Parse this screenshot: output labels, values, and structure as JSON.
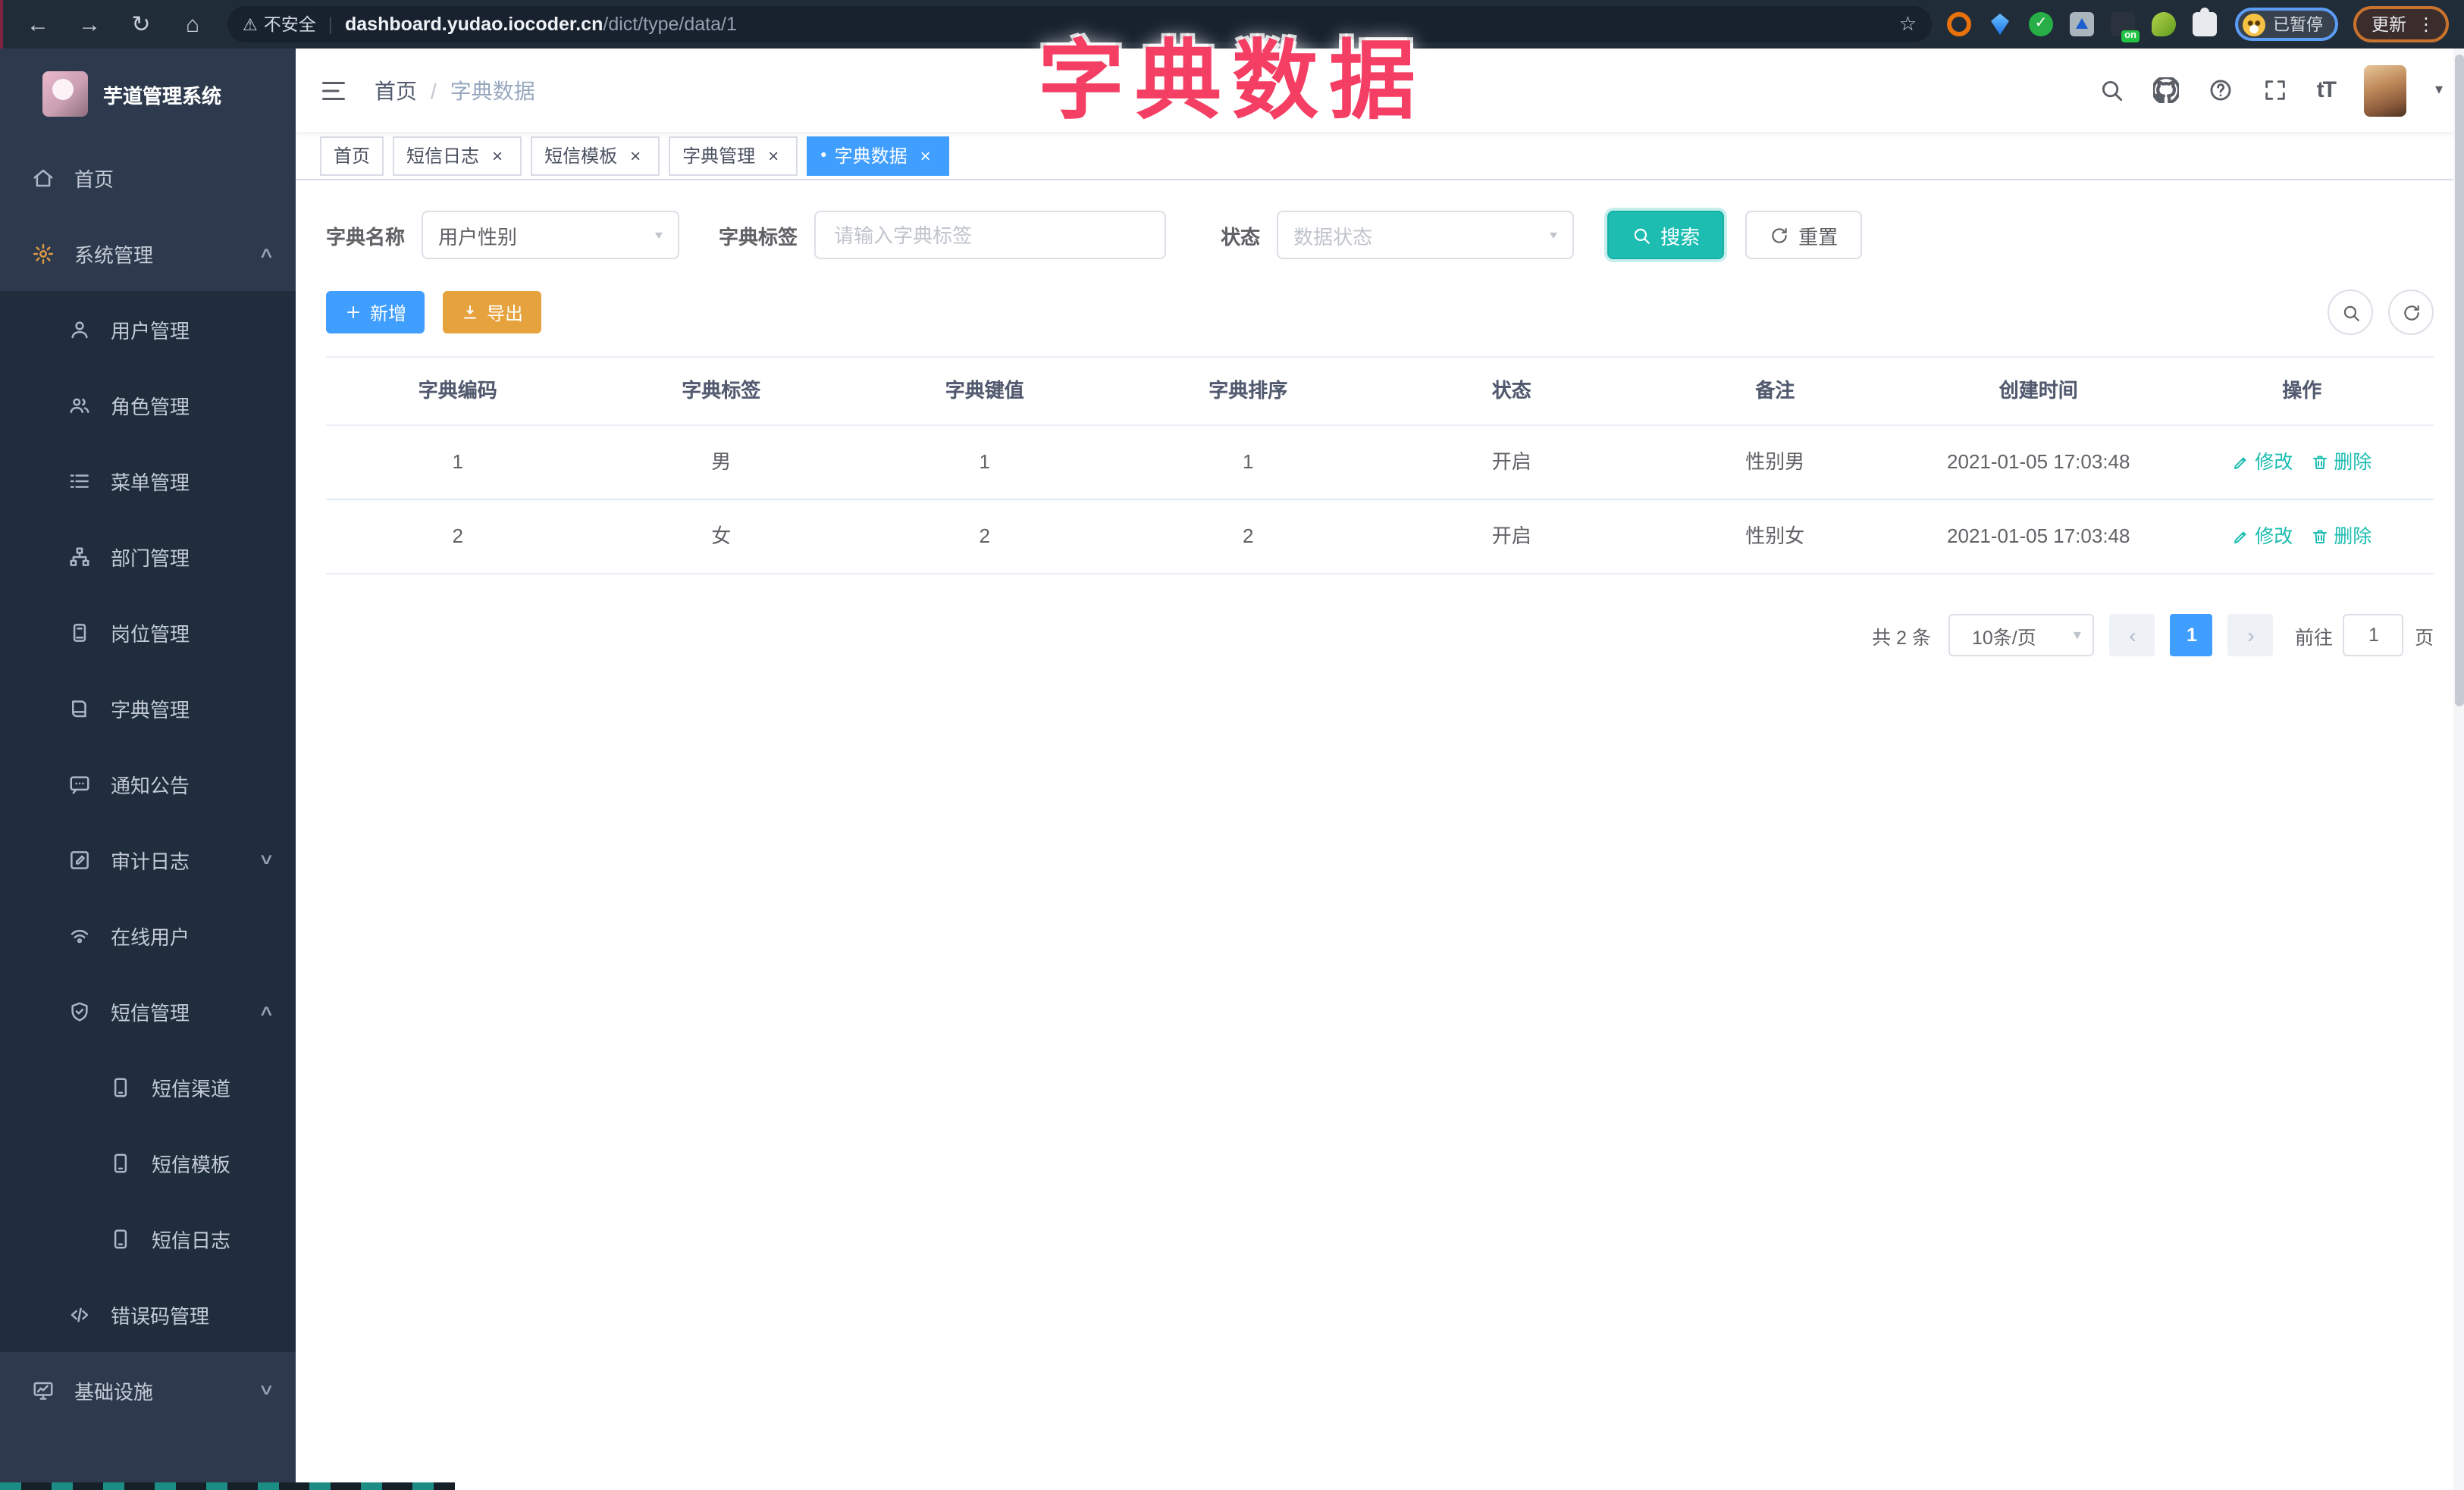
{
  "chrome": {
    "security_label": "不安全",
    "url_domain": "dashboard.yudao.iocoder.cn",
    "url_path": "/dict/type/data/1",
    "profile_status_label": "已暂停",
    "update_label": "更新"
  },
  "overlay_title": "字典数据",
  "sidebar": {
    "logo_title": "芋道管理系统",
    "items": [
      {
        "label": "首页",
        "icon": "home-icon",
        "level": 1
      },
      {
        "label": "系统管理",
        "icon": "gear-icon",
        "level": 1,
        "expanded": true
      },
      {
        "label": "用户管理",
        "icon": "user-icon",
        "level": 2
      },
      {
        "label": "角色管理",
        "icon": "users-icon",
        "level": 2
      },
      {
        "label": "菜单管理",
        "icon": "list-icon",
        "level": 2
      },
      {
        "label": "部门管理",
        "icon": "tree-icon",
        "level": 2
      },
      {
        "label": "岗位管理",
        "icon": "badge-icon",
        "level": 2
      },
      {
        "label": "字典管理",
        "icon": "book-icon",
        "level": 2
      },
      {
        "label": "通知公告",
        "icon": "message-icon",
        "level": 2
      },
      {
        "label": "审计日志",
        "icon": "edit-icon",
        "level": 2,
        "expanded": false
      },
      {
        "label": "在线用户",
        "icon": "online-icon",
        "level": 2
      },
      {
        "label": "短信管理",
        "icon": "shield-icon",
        "level": 2,
        "expanded": true
      },
      {
        "label": "短信渠道",
        "icon": "phone-icon",
        "level": 3
      },
      {
        "label": "短信模板",
        "icon": "phone-icon",
        "level": 3
      },
      {
        "label": "短信日志",
        "icon": "phone-icon",
        "level": 3
      },
      {
        "label": "错误码管理",
        "icon": "code-icon",
        "level": 2
      },
      {
        "label": "基础设施",
        "icon": "monitor-icon",
        "level": 1,
        "expanded": false
      }
    ]
  },
  "navbar": {
    "breadcrumb": {
      "home": "首页",
      "separator": "/",
      "current": "字典数据"
    }
  },
  "tabs": [
    {
      "label": "首页",
      "closable": false,
      "active": false
    },
    {
      "label": "短信日志",
      "closable": true,
      "active": false
    },
    {
      "label": "短信模板",
      "closable": true,
      "active": false
    },
    {
      "label": "字典管理",
      "closable": true,
      "active": false
    },
    {
      "label": "字典数据",
      "closable": true,
      "active": true
    }
  ],
  "search_form": {
    "name_label": "字典名称",
    "name_value": "用户性别",
    "label_label": "字典标签",
    "label_placeholder": "请输入字典标签",
    "status_label": "状态",
    "status_placeholder": "数据状态",
    "search_button": "搜索",
    "reset_button": "重置"
  },
  "toolbar": {
    "add_label": "新增",
    "export_label": "导出"
  },
  "table": {
    "headers": [
      "字典编码",
      "字典标签",
      "字典键值",
      "字典排序",
      "状态",
      "备注",
      "创建时间",
      "操作"
    ],
    "rows": [
      {
        "code": "1",
        "label": "男",
        "value": "1",
        "sort": "1",
        "status": "开启",
        "remark": "性别男",
        "created": "2021-01-05 17:03:48"
      },
      {
        "code": "2",
        "label": "女",
        "value": "2",
        "sort": "2",
        "status": "开启",
        "remark": "性别女",
        "created": "2021-01-05 17:03:48"
      }
    ],
    "actions": {
      "edit": "修改",
      "delete": "删除"
    }
  },
  "pagination": {
    "total_label": "共 2 条",
    "page_size_label": "10条/页",
    "current_page": "1",
    "goto_label": "前往",
    "goto_value": "1",
    "page_unit_label": "页"
  },
  "icons": {
    "back": "←",
    "forward": "→",
    "reload": "↻",
    "home": "⌂",
    "warning": "⚠",
    "star": "☆",
    "menu_dots": "⋮",
    "divider": "|",
    "close": "×",
    "caret_down": "▾",
    "chevron_up": "∧",
    "chevron_down": "∨",
    "active_dot": "●",
    "prev": "‹",
    "next": "›",
    "font_size": "tT",
    "check": "✓"
  },
  "colors": {
    "primary": "#409eff",
    "teal": "#1dbdb2",
    "warning": "#e6a23c",
    "overlay_pink": "#f53e63",
    "sidebar_bg": "#2d3a4d",
    "submenu_bg": "#1f2d3d",
    "chrome_bg": "#212c39"
  }
}
